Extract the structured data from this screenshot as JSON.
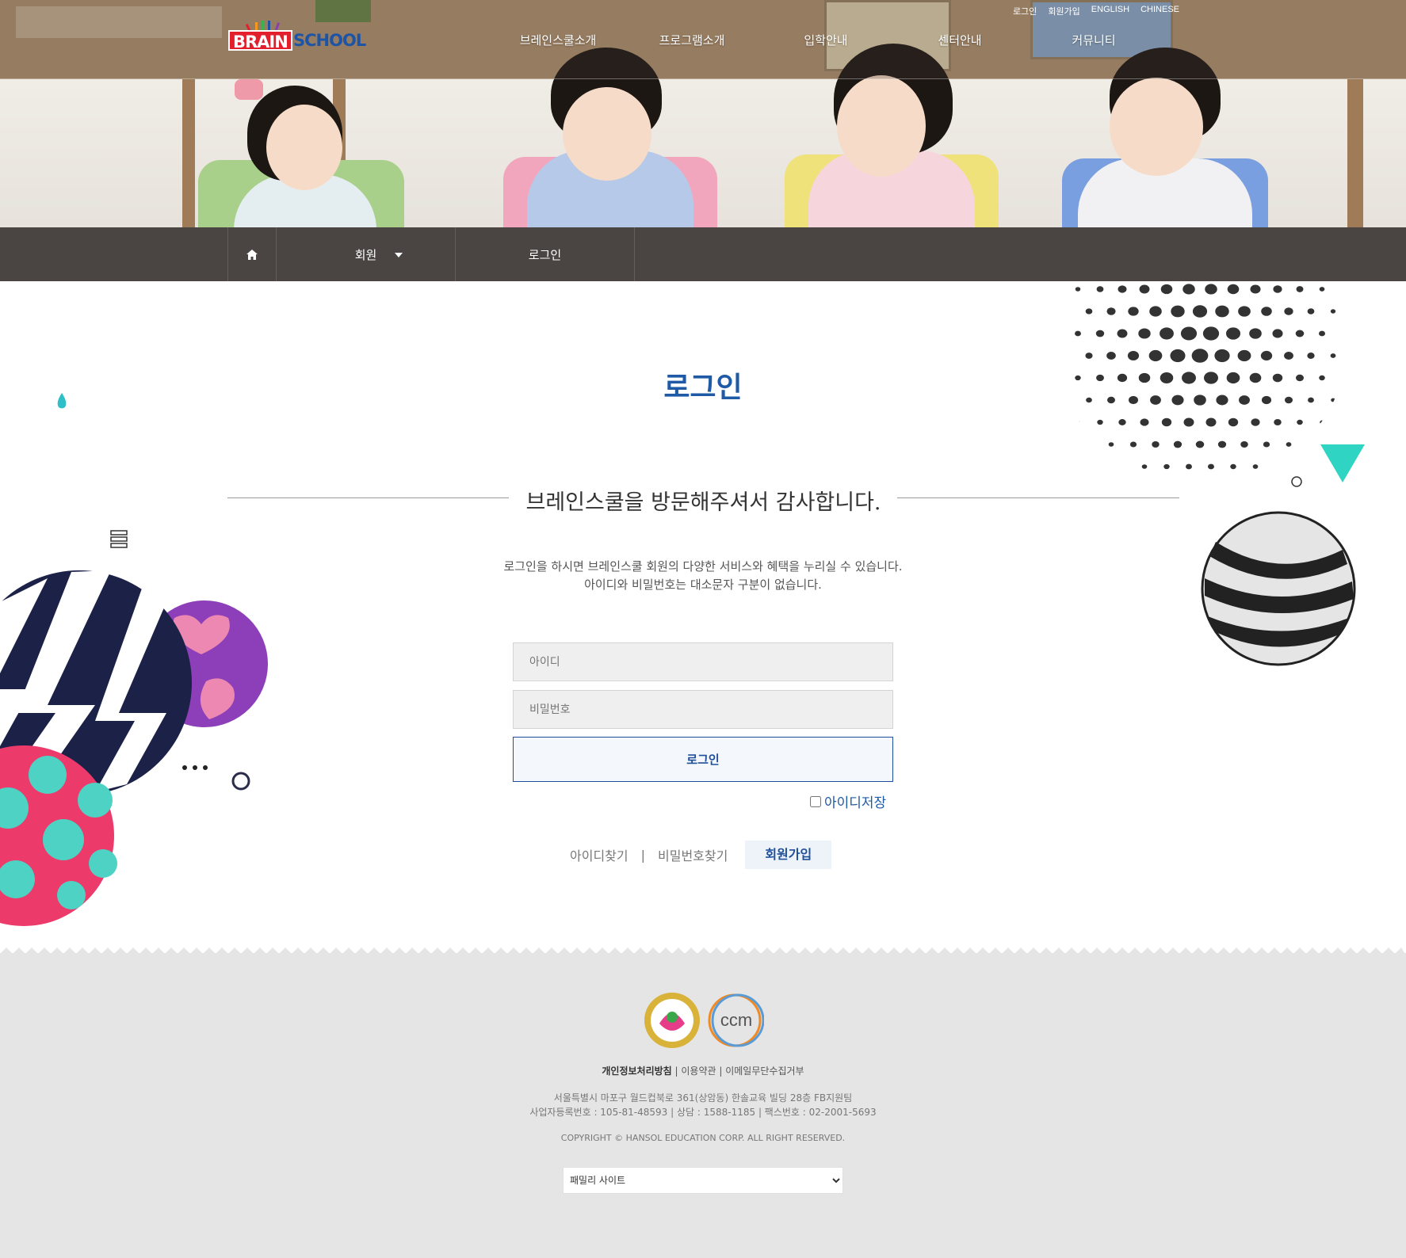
{
  "header": {
    "logo_left": "BRAIN",
    "logo_right": "SCHOOL",
    "util_links": [
      "로그인",
      "회원가입",
      "ENGLISH",
      "CHINESE"
    ],
    "gnb": [
      "브레인스쿨소개",
      "프로그램소개",
      "입학안내",
      "센터안내",
      "커뮤니티"
    ]
  },
  "breadcrumb": {
    "home_icon": "home-icon",
    "section": "회원",
    "current": "로그인"
  },
  "main": {
    "title": "로그인",
    "welcome": "브레인스쿨을 방문해주셔서 감사합니다.",
    "desc_1": "로그인을 하시면 브레인스쿨 회원의 다양한 서비스와 혜택을 누리실 수 있습니다.",
    "desc_2": "아이디와 비밀번호는 대소문자 구분이 없습니다.",
    "id_placeholder": "아이디",
    "pw_placeholder": "비밀번호",
    "login_button": "로그인",
    "save_id": "아이디저장",
    "find_id": "아이디찾기",
    "separator": "|",
    "find_pw": "비밀번호찾기",
    "join": "회원가입"
  },
  "footer": {
    "links": {
      "privacy": "개인정보처리방침",
      "rest": " | 이용약관 | 이메일무단수집거부"
    },
    "address": "서울특별시 마포구 월드컵북로 361(상암동) 한솔교육 빌딩 28층 FB지원팀",
    "business": "사업자등록번호 : 105-81-48593 | 상담 : 1588-1185 | 팩스번호 : 02-2001-5693",
    "copyright": "COPYRIGHT © HANSOL EDUCATION CORP. ALL RIGHT RESERVED.",
    "ccm_logo": "ccm",
    "family_site": "패밀리 사이트"
  },
  "colors": {
    "accent": "#1f5aa6",
    "breadcrumb_bg": "#4a4443",
    "footer_bg": "#e5e5e5",
    "logo_red": "#e41f2d"
  }
}
